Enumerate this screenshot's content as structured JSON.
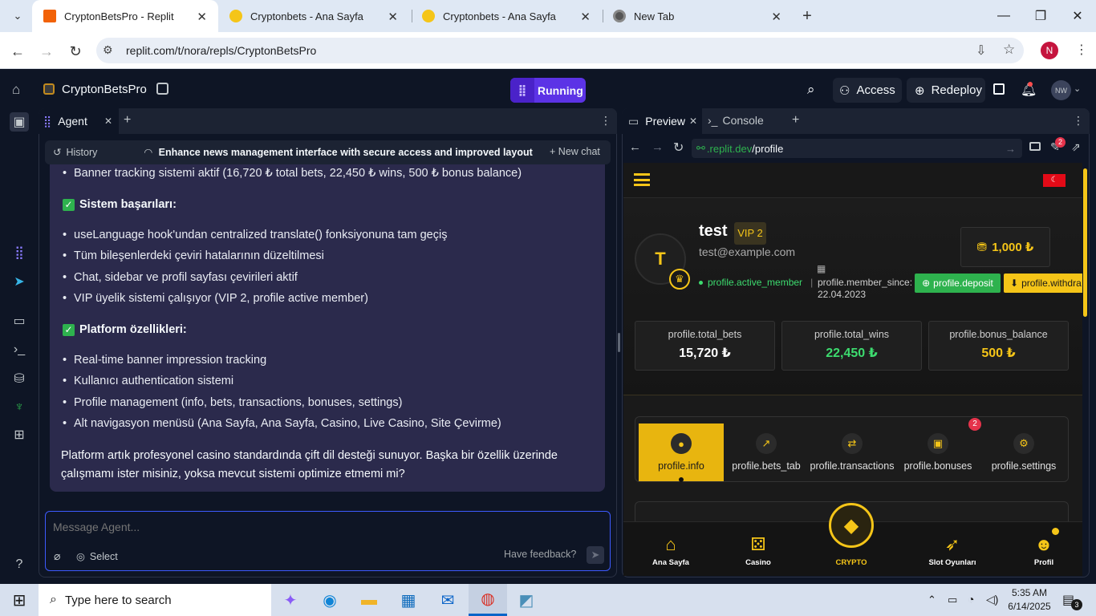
{
  "browser": {
    "tabs": [
      {
        "title": "CryptonBetsPro - Replit"
      },
      {
        "title": "Cryptonbets - Ana Sayfa"
      },
      {
        "title": "Cryptonbets - Ana Sayfa"
      },
      {
        "title": "New Tab"
      }
    ],
    "url": "replit.com/t/nora/repls/CryptonBetsPro",
    "profile_initial": "N"
  },
  "replit": {
    "project_name": "CryptonBetsPro",
    "run_label": "Running",
    "access_label": "Access",
    "redeploy_label": "Redeploy",
    "user_initials": "NW",
    "agent_tab": "Agent",
    "history_label": "History",
    "chat_title": "Enhance news management interface with secure access and improved layout",
    "new_chat_label": "New chat",
    "message": {
      "first_bullet": "Banner tracking sistemi aktif (16,720 ₺ total bets, 22,450 ₺ wins, 500 ₺ bonus balance)",
      "section1_title": "Sistem başarıları:",
      "section1_items": [
        "useLanguage hook'undan centralized translate() fonksiyonuna tam geçiş",
        "Tüm bileşenlerdeki çeviri hatalarının düzeltilmesi",
        "Chat, sidebar ve profil sayfası çevirileri aktif",
        "VIP üyelik sistemi çalışıyor (VIP 2, profile active member)"
      ],
      "section2_title": "Platform özellikleri:",
      "section2_items": [
        "Real-time banner impression tracking",
        "Kullanıcı authentication sistemi",
        "Profile management (info, bets, transactions, bonuses, settings)",
        "Alt navigasyon menüsü (Ana Sayfa, Ana Sayfa, Casino, Live Casino, Site Çevirme)"
      ],
      "closing": "Platform artık profesyonel casino standardında çift dil desteği sunuyor. Başka bir özellik üzerinde çalışmamı ister misiniz, yoksa mevcut sistemi optimize etmemi mi?"
    },
    "input_placeholder": "Message Agent...",
    "select_label": "Select",
    "feedback_label": "Have feedback?",
    "preview_tab": "Preview",
    "console_tab": "Console",
    "preview_url_host": ".replit.dev",
    "preview_url_path": "/profile",
    "notif_badge": "2"
  },
  "site": {
    "username": "test",
    "vip": "VIP 2",
    "email": "test@example.com",
    "avatar_letter": "T",
    "balance": "1,000 ₺",
    "status": "profile.active_member",
    "member_since_label": "profile.member_since:",
    "member_since_date": "22.04.2023",
    "deposit_label": "profile.deposit",
    "withdraw_label": "profile.withdra",
    "stats": [
      {
        "label": "profile.total_bets",
        "value": "15,720 ₺",
        "color": "#ffffff"
      },
      {
        "label": "profile.total_wins",
        "value": "22,450 ₺",
        "color": "#3ddc6f"
      },
      {
        "label": "profile.bonus_balance",
        "value": "500 ₺",
        "color": "#f5c518"
      }
    ],
    "profile_tabs": [
      {
        "label": "profile.info",
        "icon": "user-icon"
      },
      {
        "label": "profile.bets_tab",
        "icon": "chart-icon"
      },
      {
        "label": "profile.transactions",
        "icon": "exchange-icon"
      },
      {
        "label": "profile.bonuses",
        "icon": "gift-icon"
      },
      {
        "label": "profile.settings",
        "icon": "gear-icon"
      }
    ],
    "bonus_badge": "2",
    "bottom_nav": [
      {
        "label": "Ana Sayfa",
        "icon": "home-icon"
      },
      {
        "label": "Casino",
        "icon": "dice-icon"
      },
      {
        "label": "CRYPTO",
        "icon": "diamond-icon"
      },
      {
        "label": "Slot Oyunları",
        "icon": "rocket-icon"
      },
      {
        "label": "Profil",
        "icon": "profile-icon"
      }
    ],
    "accent": "#f5c518"
  },
  "taskbar": {
    "search_placeholder": "Type here to search",
    "time": "5:35 AM",
    "date": "6/14/2025",
    "notif_count": "3"
  }
}
